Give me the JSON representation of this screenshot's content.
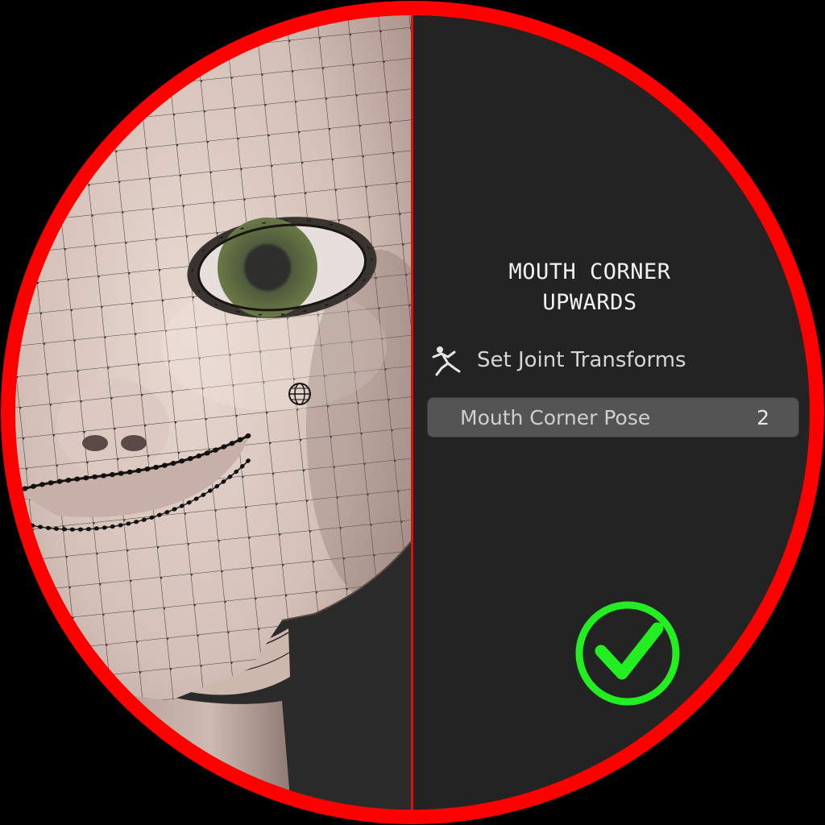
{
  "panel": {
    "title_line1": "MOUTH CORNER",
    "title_line2": "UPWARDS",
    "operator_label": "Set Joint Transforms",
    "operator_icon": "running-figure-icon",
    "property": {
      "label": "Mouth Corner Pose",
      "value": "2"
    },
    "status_icon": "checkmark-icon"
  },
  "colors": {
    "ring": "#ff0000",
    "divider": "#e01010",
    "checkmark": "#22ee22",
    "panel_bg": "#232323",
    "field_bg": "#545454",
    "skin": "#d8c4bc"
  }
}
